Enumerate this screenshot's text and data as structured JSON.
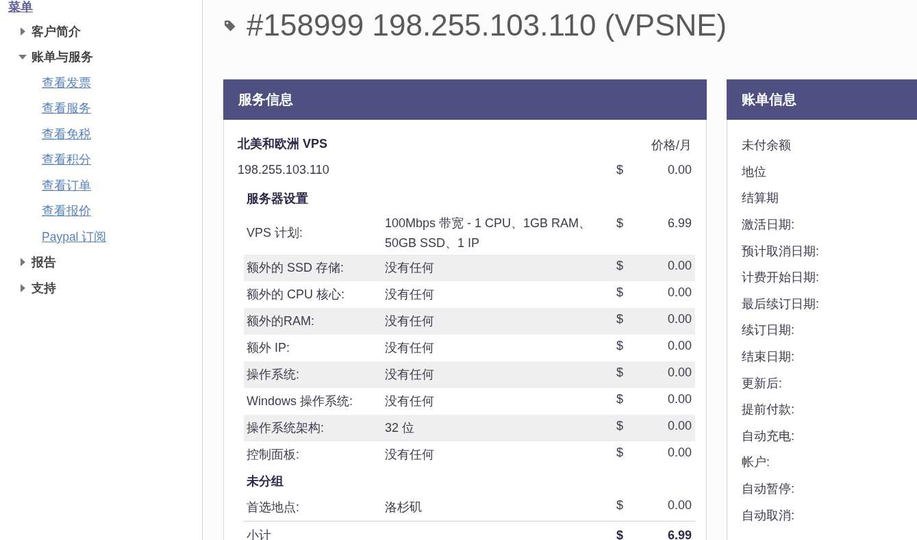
{
  "sidebar": {
    "title": "菜单",
    "items": [
      {
        "label": "客户简介",
        "expanded": false
      },
      {
        "label": "账单与服务",
        "expanded": true,
        "children": [
          {
            "label": "查看发票"
          },
          {
            "label": "查看服务"
          },
          {
            "label": "查看免税"
          },
          {
            "label": "查看积分"
          },
          {
            "label": "查看订单"
          },
          {
            "label": "查看报价"
          },
          {
            "label": "Paypal 订阅"
          }
        ]
      },
      {
        "label": "报告",
        "expanded": false
      },
      {
        "label": "支持",
        "expanded": false
      }
    ]
  },
  "page_title": "#158999 198.255.103.110 (VPSNE)",
  "service_panel": {
    "title": "服务信息",
    "product": "北美和欧洲 VPS",
    "price_heading": "价格/月",
    "hostname": {
      "text": "198.255.103.110",
      "currency": "$",
      "price": "0.00"
    },
    "groups": [
      {
        "title": "服务器设置",
        "rows": [
          {
            "label": "VPS 计划:",
            "value": "100Mbps 带宽 - 1 CPU、1GB RAM、50GB SSD、1 IP",
            "currency": "$",
            "price": "6.99"
          },
          {
            "label": "额外的 SSD 存储:",
            "value": "没有任何",
            "currency": "$",
            "price": "0.00"
          },
          {
            "label": "额外的 CPU 核心:",
            "value": "没有任何",
            "currency": "$",
            "price": "0.00"
          },
          {
            "label": "额外的RAM:",
            "value": "没有任何",
            "currency": "$",
            "price": "0.00"
          },
          {
            "label": "额外 IP:",
            "value": "没有任何",
            "currency": "$",
            "price": "0.00"
          },
          {
            "label": "操作系统:",
            "value": "没有任何",
            "currency": "$",
            "price": "0.00"
          },
          {
            "label": "Windows 操作系统:",
            "value": "没有任何",
            "currency": "$",
            "price": "0.00"
          },
          {
            "label": "操作系统架构:",
            "value": "32 位",
            "currency": "$",
            "price": "0.00"
          },
          {
            "label": "控制面板:",
            "value": "没有任何",
            "currency": "$",
            "price": "0.00"
          }
        ]
      },
      {
        "title": "未分组",
        "rows": [
          {
            "label": "首选地点:",
            "value": "洛杉矶",
            "currency": "$",
            "price": "0.00"
          }
        ]
      }
    ],
    "subtotal": {
      "label": "小计",
      "currency": "$",
      "price": "6.99"
    }
  },
  "billing_panel": {
    "title": "账单信息",
    "fields": [
      "未付余额",
      "地位",
      "结算期",
      "激活日期:",
      "预计取消日期:",
      "计费开始日期:",
      "最后续订日期:",
      "续订日期:",
      "结束日期:",
      "更新后:",
      "提前付款:",
      "自动充电:",
      "帐户:",
      "自动暂停:",
      "自动取消:"
    ]
  }
}
